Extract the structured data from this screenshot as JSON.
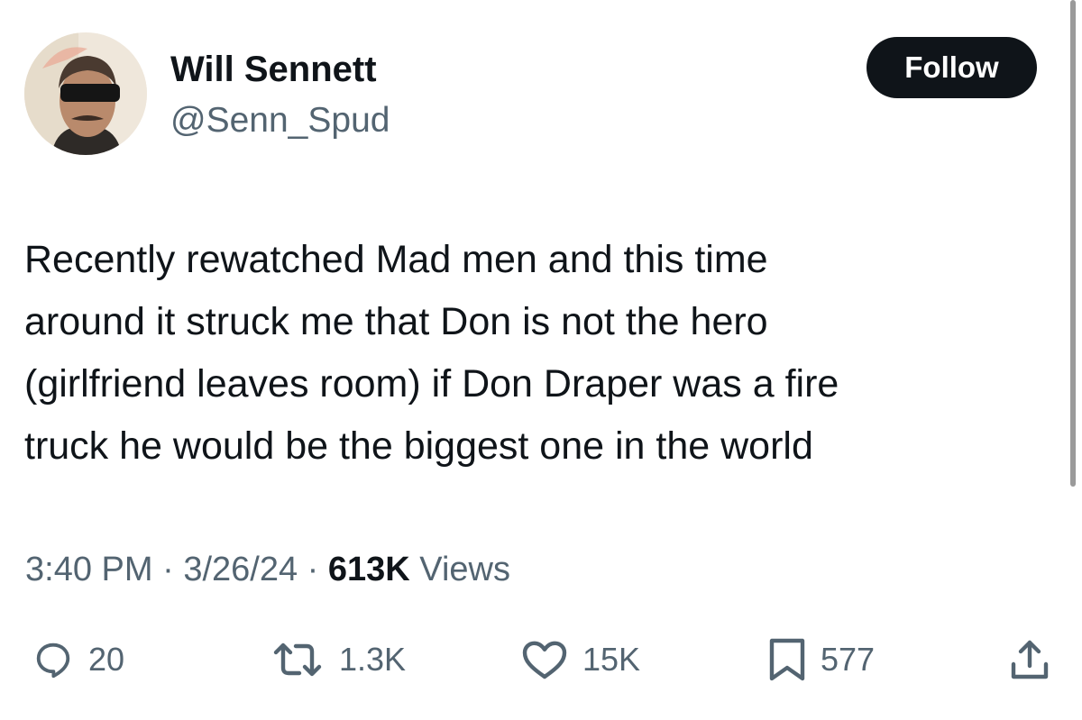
{
  "author": {
    "display_name": "Will Sennett",
    "handle": "@Senn_Spud"
  },
  "follow_button": {
    "label": "Follow"
  },
  "tweet": {
    "lines": [
      "Recently rewatched Mad men and this time",
      "around it struck me that Don is not the hero",
      "(girlfriend leaves room) if Don Draper was a fire",
      "truck he would be the biggest one in the world"
    ]
  },
  "meta": {
    "time": "3:40 PM",
    "separator": " · ",
    "date": "3/26/24",
    "views_count": "613K",
    "views_label": " Views"
  },
  "actions": {
    "reply": {
      "icon": "reply-icon",
      "count": "20"
    },
    "repost": {
      "icon": "repost-icon",
      "count": "1.3K"
    },
    "like": {
      "icon": "like-icon",
      "count": "15K"
    },
    "bookmark": {
      "icon": "bookmark-icon",
      "count": "577"
    },
    "share": {
      "icon": "share-icon"
    }
  },
  "colors": {
    "text_primary": "#0f1419",
    "text_secondary": "#536471",
    "button_bg": "#0f1419",
    "button_text": "#ffffff"
  }
}
